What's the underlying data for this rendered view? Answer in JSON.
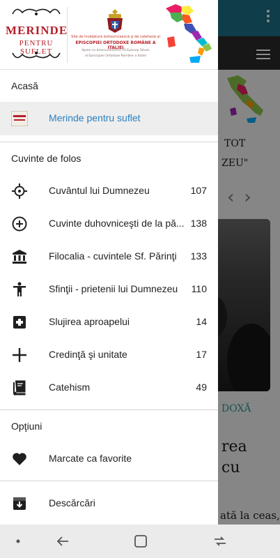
{
  "background": {
    "headline_fragments": [
      "TOT",
      "ZEU\""
    ],
    "category": "DOXĂ",
    "article_fragments": [
      "rea",
      "cu",
      "ată la ceas,"
    ]
  },
  "drawer": {
    "header": {
      "logo_title": "MERINDE",
      "logo_subtitle": "PENTRU SUFLET",
      "line1": "Site de învăţătură duhovnicească şi de cateheză al",
      "line2": "EPISCOPIEI ORTODOXE ROMÂNE A ITALIEI",
      "line3": "Apare cu binecuvântarea PS Episcop Siluan",
      "line4": "al Episcopiei Ortodoxe Române a Italiei"
    },
    "sections": {
      "home": "Acasă",
      "words": "Cuvinte de folos",
      "options": "Opţiuni"
    },
    "active_item": {
      "label": "Merinde pentru suflet"
    },
    "items": [
      {
        "icon": "crosshair-icon",
        "label": "Cuvântul lui Dumnezeu",
        "count": "107"
      },
      {
        "icon": "plus-circle-icon",
        "label": "Cuvinte duhovniceşti de la pă...",
        "count": "138"
      },
      {
        "icon": "bank-icon",
        "label": "Filocalia - cuvintele Sf. Părinţi",
        "count": "133"
      },
      {
        "icon": "person-icon",
        "label": "Sfinţii - prietenii lui Dumnezeu",
        "count": "110"
      },
      {
        "icon": "medical-plus-icon",
        "label": "Slujirea aproapelui",
        "count": "14"
      },
      {
        "icon": "plus-icon",
        "label": "Credinţă şi unitate",
        "count": "17"
      },
      {
        "icon": "book-icon",
        "label": "Catehism",
        "count": "49"
      }
    ],
    "options_items": [
      {
        "icon": "heart-icon",
        "label": "Marcate ca favorite"
      },
      {
        "icon": "download-box-icon",
        "label": "Descărcări"
      }
    ]
  },
  "colors": {
    "active_label": "#2a7fc0",
    "active_bg": "#eeeeee",
    "brand_red": "#b4202a",
    "topbar": "#1d6f86"
  }
}
